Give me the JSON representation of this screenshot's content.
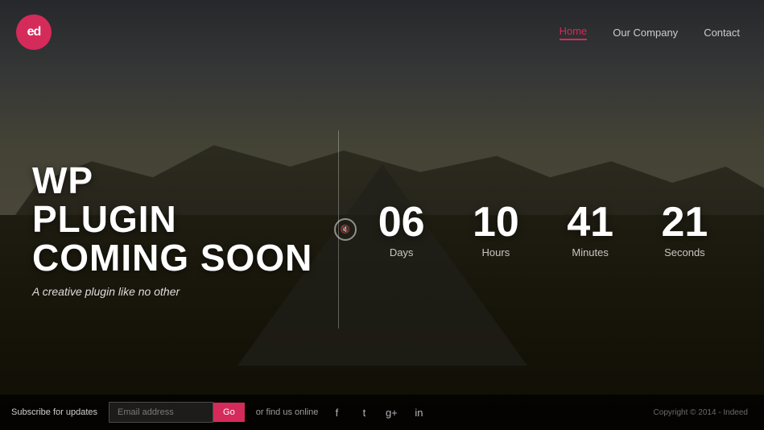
{
  "logo": {
    "text": "ed"
  },
  "nav": {
    "items": [
      {
        "label": "Home",
        "active": true
      },
      {
        "label": "Our Company",
        "active": false
      },
      {
        "label": "Contact",
        "active": false
      }
    ]
  },
  "hero": {
    "line1": "WP",
    "line2": "PLUGIN",
    "line3": "COMING SOON",
    "subtitle": "A creative plugin like no other"
  },
  "countdown": {
    "days_number": "06",
    "days_label": "Days",
    "hours_number": "10",
    "hours_label": "Hours",
    "minutes_number": "41",
    "minutes_label": "Minutes",
    "seconds_number": "21",
    "seconds_label": "Seconds"
  },
  "footer": {
    "subscribe_label": "Subscribe for updates",
    "email_placeholder": "Email address",
    "go_button": "Go",
    "find_us_label": "or find us online",
    "social": {
      "facebook": "f",
      "twitter": "t",
      "gplus": "g+",
      "linkedin": "in"
    },
    "copyright": "Copyright © 2014 - Indeed"
  }
}
